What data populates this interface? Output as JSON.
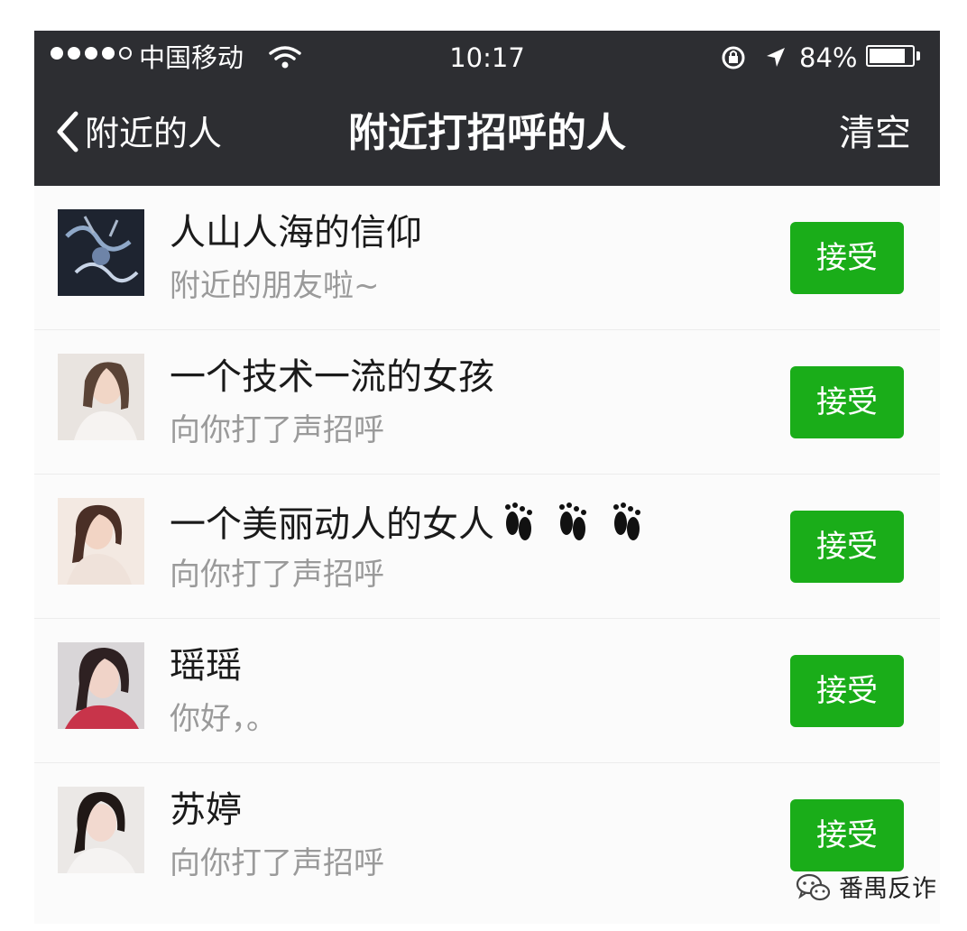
{
  "status_bar": {
    "carrier": "中国移动",
    "time": "10:17",
    "battery_percent": "84%",
    "battery_level": 0.84
  },
  "nav": {
    "back_label": "附近的人",
    "title": "附近打招呼的人",
    "clear_label": "清空"
  },
  "greetings": [
    {
      "name": "人山人海的信仰",
      "message": "附近的朋友啦~",
      "accept_label": "接受",
      "avatar": "avatar-dark-art"
    },
    {
      "name": "一个技术一流的女孩",
      "message": "向你打了声招呼",
      "accept_label": "接受",
      "avatar": "avatar-woman-1"
    },
    {
      "name": "一个美丽动人的女人",
      "name_emoji": "footprints",
      "message": "向你打了声招呼",
      "accept_label": "接受",
      "avatar": "avatar-woman-2"
    },
    {
      "name": "瑶瑶",
      "message": "你好，。",
      "accept_label": "接受",
      "avatar": "avatar-woman-3"
    },
    {
      "name": "苏婷",
      "message": "向你打了声招呼",
      "accept_label": "接受",
      "avatar": "avatar-woman-4"
    }
  ],
  "watermark": {
    "text": "番禺反诈",
    "icon": "wechat-icon"
  },
  "colors": {
    "nav_background": "#2d2e32",
    "accept_green": "#1aad19",
    "secondary_text": "#9a9a9a"
  }
}
